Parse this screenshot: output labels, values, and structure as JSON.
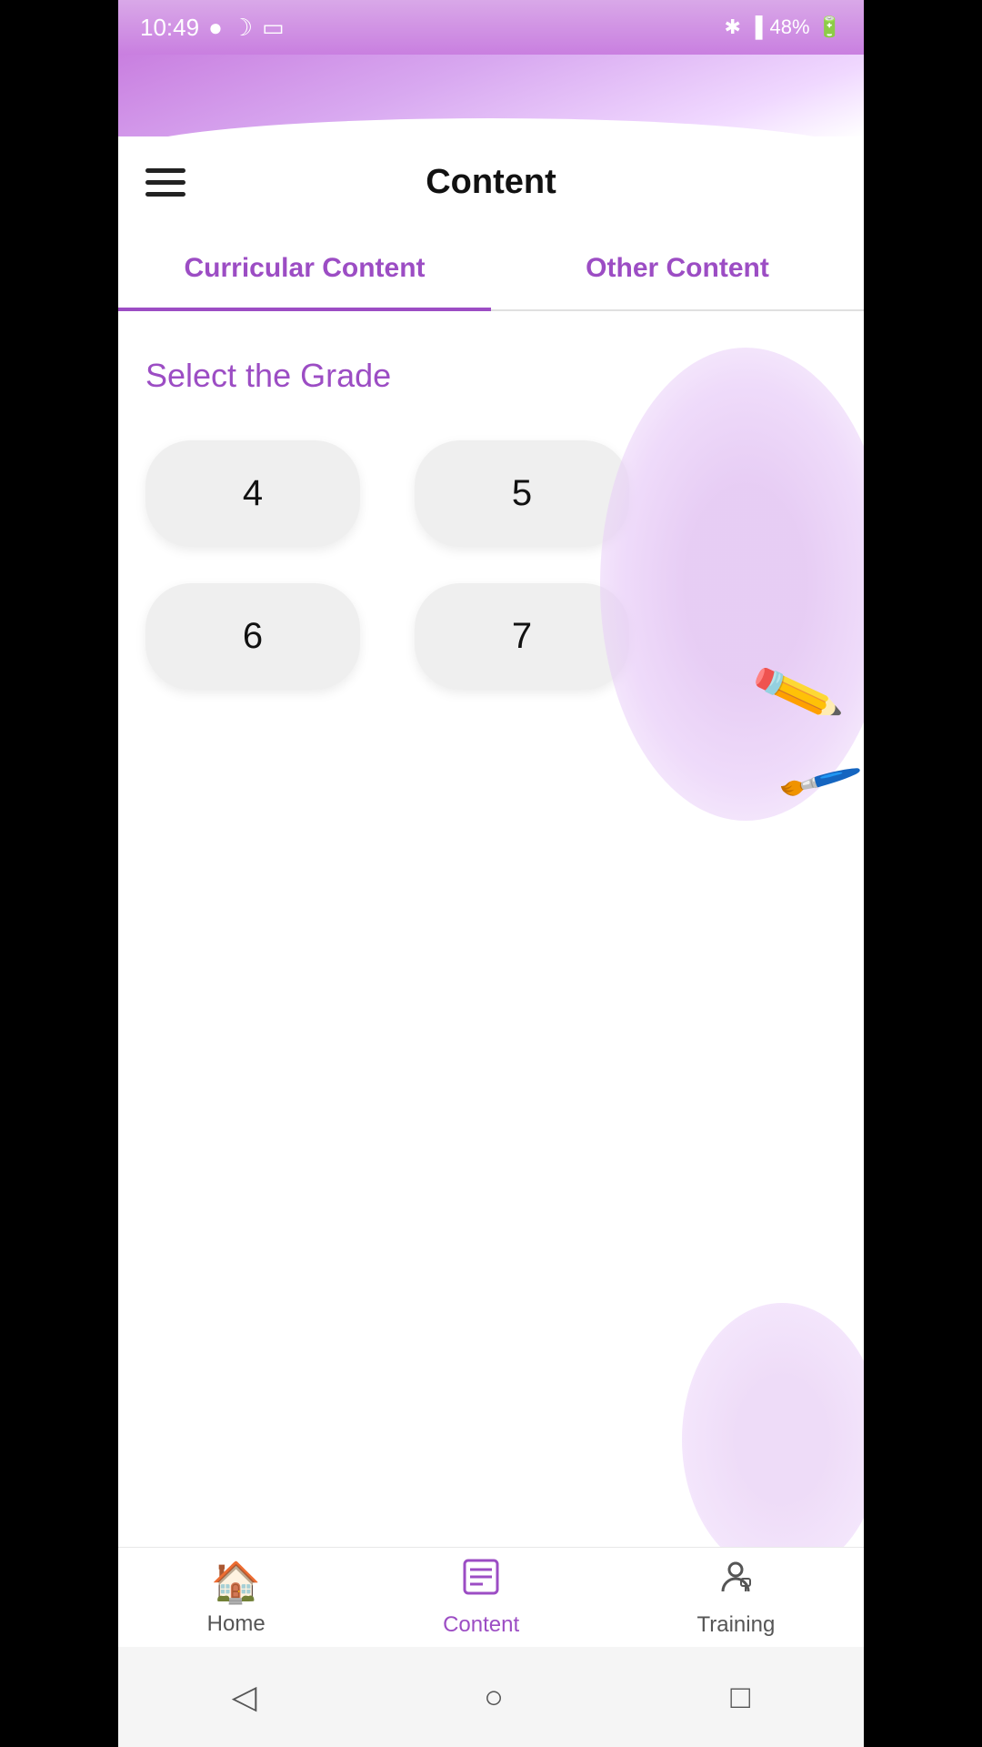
{
  "statusBar": {
    "time": "10:49",
    "battery": "48%"
  },
  "header": {
    "title": "Content",
    "menuIcon": "menu-icon"
  },
  "tabs": [
    {
      "id": "curricular",
      "label": "Curricular Content",
      "active": true
    },
    {
      "id": "other",
      "label": "Other Content",
      "active": false
    }
  ],
  "gradeSection": {
    "title": "Select the Grade",
    "grades": [
      {
        "value": "4"
      },
      {
        "value": "5"
      },
      {
        "value": "6"
      },
      {
        "value": "7"
      }
    ]
  },
  "bottomNav": [
    {
      "id": "home",
      "label": "Home",
      "icon": "🏠",
      "active": false
    },
    {
      "id": "content",
      "label": "Content",
      "icon": "📋",
      "active": true
    },
    {
      "id": "training",
      "label": "Training",
      "icon": "👤",
      "active": false
    }
  ],
  "androidBar": {
    "back": "◁",
    "home": "○",
    "recent": "□"
  },
  "colors": {
    "primary": "#9c4dc4",
    "tabActive": "#9c4dc4",
    "gradeBtn": "#efefef"
  }
}
